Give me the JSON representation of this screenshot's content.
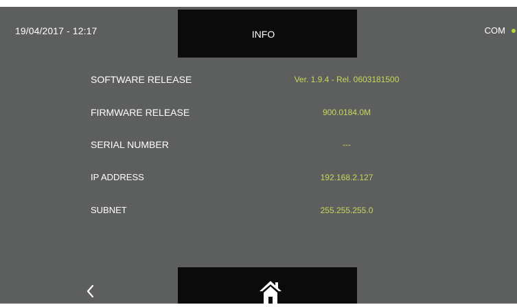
{
  "header": {
    "datetime": "19/04/2017 - 12:17",
    "title": "INFO",
    "com_label": "COM",
    "com_status_color": "#b6d23a"
  },
  "info": {
    "software_release": {
      "label": "SOFTWARE RELEASE",
      "value": "Ver. 1.9.4 - Rel. 0603181500"
    },
    "firmware_release": {
      "label": "FIRMWARE RELEASE",
      "value": "900.0184.0M"
    },
    "serial_number": {
      "label": "SERIAL NUMBER",
      "value": "---"
    },
    "ip_address": {
      "label": "IP ADDRESS",
      "value": "192.168.2.127"
    },
    "subnet": {
      "label": "SUBNET",
      "value": "255.255.255.0"
    }
  },
  "footer": {
    "back_icon": "chevron-left-icon",
    "home_icon": "home-icon"
  },
  "colors": {
    "background": "#5d5f5f",
    "panel": "#0b0b0b",
    "value_text": "#c8d85a",
    "label_text": "#ffffff"
  }
}
